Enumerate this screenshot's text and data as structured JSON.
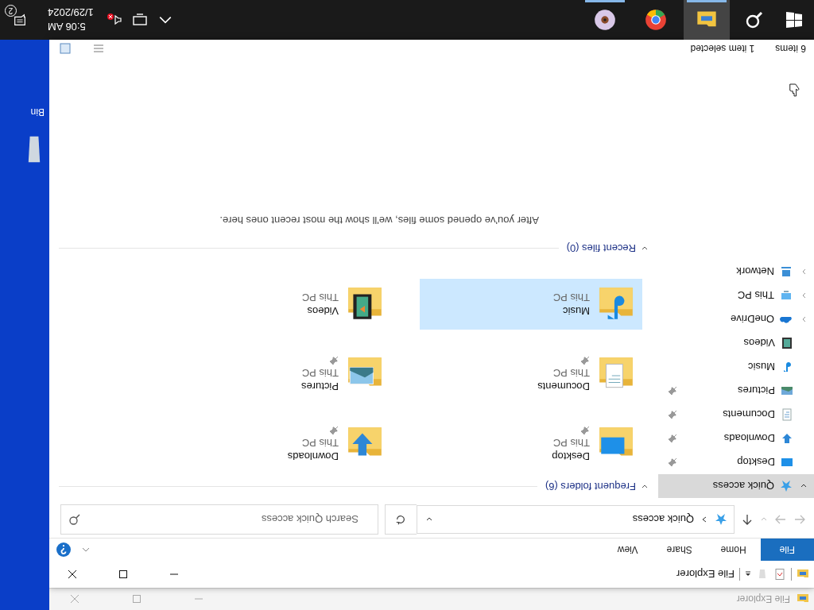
{
  "background_window": {
    "title": "File Explorer"
  },
  "window": {
    "title": "File Explorer"
  },
  "ribbon_tabs": [
    {
      "label": "File",
      "selected": true
    },
    {
      "label": "Home",
      "selected": false
    },
    {
      "label": "Share",
      "selected": false
    },
    {
      "label": "View",
      "selected": false
    }
  ],
  "address_bar": {
    "path": "Quick access",
    "search_placeholder": "Search Quick access"
  },
  "nav_pane": {
    "items": [
      {
        "label": "Quick access",
        "kind": "star",
        "expanded": true,
        "selected": true,
        "children": [
          {
            "label": "Desktop",
            "kind": "desktop",
            "pinned": true
          },
          {
            "label": "Downloads",
            "kind": "downloads",
            "pinned": true
          },
          {
            "label": "Documents",
            "kind": "documents",
            "pinned": true
          },
          {
            "label": "Pictures",
            "kind": "pictures",
            "pinned": true
          },
          {
            "label": "Music",
            "kind": "music",
            "pinned": false
          },
          {
            "label": "Videos",
            "kind": "videos",
            "pinned": false
          }
        ]
      },
      {
        "label": "OneDrive",
        "kind": "cloud",
        "expanded": false,
        "selected": false
      },
      {
        "label": "This PC",
        "kind": "pc",
        "expanded": false,
        "selected": false
      },
      {
        "label": "Network",
        "kind": "network",
        "expanded": false,
        "selected": false
      }
    ]
  },
  "sections": [
    {
      "title": "Frequent folders (6)",
      "expanded": true,
      "tiles": [
        {
          "name": "Desktop",
          "location": "This PC",
          "kind": "desktop",
          "pinned": true,
          "selected": false
        },
        {
          "name": "Downloads",
          "location": "This PC",
          "kind": "downloads",
          "pinned": true,
          "selected": false
        },
        {
          "name": "Documents",
          "location": "This PC",
          "kind": "documents",
          "pinned": true,
          "selected": false
        },
        {
          "name": "Pictures",
          "location": "This PC",
          "kind": "pictures",
          "pinned": true,
          "selected": false
        },
        {
          "name": "Music",
          "location": "This PC",
          "kind": "music",
          "pinned": false,
          "selected": true
        },
        {
          "name": "Videos",
          "location": "This PC",
          "kind": "videos",
          "pinned": false,
          "selected": false
        }
      ]
    },
    {
      "title": "Recent files (0)",
      "expanded": true,
      "message": "After you've opened some files, we'll show the most recent ones here."
    }
  ],
  "status_bar": {
    "item_count": "6 items",
    "selection": "1 item selected"
  },
  "desktop": {
    "icon_label": "Bin"
  },
  "taskbar": {
    "apps": [
      {
        "kind": "explorer",
        "running": true,
        "active": true
      },
      {
        "kind": "chrome",
        "running": false,
        "active": false
      },
      {
        "kind": "disc",
        "running": true,
        "active": false
      }
    ],
    "time": "5:06 AM",
    "date": "1/29/2024",
    "notification_count": "2"
  }
}
